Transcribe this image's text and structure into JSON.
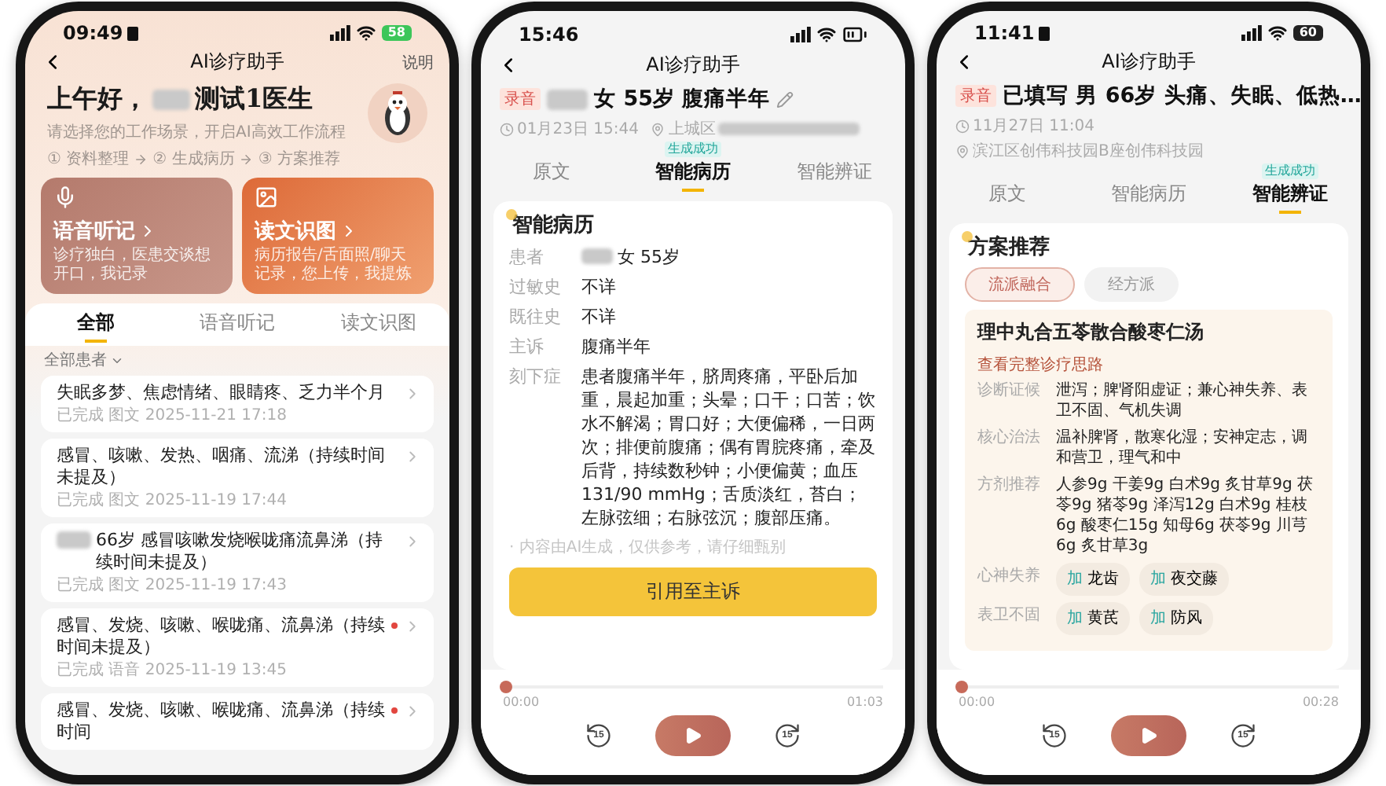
{
  "screens": [
    {
      "kind": "home",
      "status": {
        "time": "09:49",
        "notification": true,
        "battery": "58",
        "charging": true
      },
      "nav": {
        "title": "AI诊疗助手",
        "action": "说明"
      },
      "greeting": "上午好，",
      "doctor_name": "测试1医生",
      "subtitle": "请选择您的工作场景，开启AI高效工作流程",
      "steps": [
        "① 资料整理",
        "② 生成病历",
        "③ 方案推荐"
      ],
      "cards": [
        {
          "kind": "voice",
          "title": "语音听记",
          "description": "诊疗独白，医患交谈想开口，我记录"
        },
        {
          "kind": "image",
          "title": "读文识图",
          "description": "病历报告/舌面照/聊天记录，您上传，我提炼"
        }
      ],
      "tabs": [
        {
          "label": "全部",
          "selected": true
        },
        {
          "label": "语音听记",
          "selected": false
        },
        {
          "label": "读文识图",
          "selected": false
        }
      ],
      "filter": "全部患者",
      "records": [
        {
          "title": "失眠多梦、焦虑情绪、眼睛疼、乏力半个月",
          "name_hidden": false,
          "unread": false,
          "status": "已完成",
          "source": "图文",
          "time": "2025-11-21 17:18"
        },
        {
          "title": "感冒、咳嗽、发热、咽痛、流涕（持续时间未提及）",
          "name_hidden": false,
          "unread": false,
          "status": "已完成",
          "source": "图文",
          "time": "2025-11-19 17:44"
        },
        {
          "title": "66岁 感冒咳嗽发烧喉咙痛流鼻涕（持续时间未提及）",
          "name_hidden": true,
          "unread": false,
          "status": "已完成",
          "source": "图文",
          "time": "2025-11-19 17:43"
        },
        {
          "title": "感冒、发烧、咳嗽、喉咙痛、流鼻涕（持续时间未提及）",
          "name_hidden": false,
          "unread": true,
          "status": "已完成",
          "source": "语音",
          "time": "2025-11-19 13:45"
        },
        {
          "title": "感冒、发烧、咳嗽、喉咙痛、流鼻涕（持续时间",
          "name_hidden": false,
          "unread": true
        }
      ]
    },
    {
      "kind": "record",
      "status": {
        "time": "15:46",
        "notification": false
      },
      "nav": {
        "title": "AI诊疗助手"
      },
      "tag": "录音",
      "title": "女 55岁 腹痛半年",
      "name_hidden": true,
      "date": "01月23日 15:44",
      "location": "上城区",
      "location_hidden": true,
      "tabs": [
        {
          "label": "原文",
          "selected": false
        },
        {
          "label": "智能病历",
          "selected": true,
          "badge": "生成成功"
        },
        {
          "label": "智能辨证",
          "selected": false
        }
      ],
      "card": {
        "title": "智能病历",
        "fields": [
          {
            "label": "患者",
            "value": "女 55岁",
            "name_hidden": true
          },
          {
            "label": "过敏史",
            "value": "不详",
            "name_hidden": false
          },
          {
            "label": "既往史",
            "value": "不详",
            "name_hidden": false
          },
          {
            "label": "主诉",
            "value": "腹痛半年",
            "name_hidden": false
          },
          {
            "label": "刻下症",
            "value": "患者腹痛半年，脐周疼痛，平卧后加重，晨起加重；头晕；口干；口苦；饮水不解渴；胃口好；大便偏稀，一日两次；排便前腹痛；偶有胃脘疼痛，牵及后背，持续数秒钟；小便偏黄；血压131/90 mmHg；舌质淡红，苔白；左脉弦细；右脉弦沉；腹部压痛。",
            "name_hidden": false
          }
        ],
        "note": "· 内容由AI生成，仅供参考，请仔细甄别",
        "button": "引用至主诉"
      },
      "player": {
        "level": 0,
        "start": "00:00",
        "end": "01:03",
        "back": "15",
        "forward": "15"
      }
    },
    {
      "kind": "plan",
      "status": {
        "time": "11:41",
        "notification": true,
        "battery": "60",
        "charging": false
      },
      "nav": {
        "title": "AI诊疗助手"
      },
      "tag": "录音",
      "title": "已填写 男 66岁 头痛、失眠、低热…",
      "name_hidden": false,
      "date": "11月27日 11:04",
      "location": "滨江区创伟科技园B座创伟科技园",
      "location_hidden": false,
      "tabs": [
        {
          "label": "原文",
          "selected": false
        },
        {
          "label": "智能病历",
          "selected": false
        },
        {
          "label": "智能辨证",
          "selected": true,
          "badge": "生成成功"
        }
      ],
      "card": {
        "title": "方案推荐",
        "schools": [
          {
            "label": "流派融合",
            "selected": true
          },
          {
            "label": "经方派",
            "selected": false
          }
        ],
        "plan": {
          "name": "理中丸合五苓散合酸枣仁汤",
          "link": "查看完整诊疗思路",
          "fields": [
            {
              "label": "诊断证候",
              "value": "泄泻；脾肾阳虚证；兼心神失养、表卫不固、气机失调"
            },
            {
              "label": "核心治法",
              "value": "温补脾肾，散寒化湿；安神定志，调和营卫，理气和中"
            },
            {
              "label": "方剂推荐",
              "value": "人参9g 干姜9g 白术9g 炙甘草9g 茯苓9g 猪苓9g 泽泻12g 白术9g 桂枝6g 酸枣仁15g 知母6g 茯苓9g 川芎6g 炙甘草3g"
            }
          ],
          "additions": [
            {
              "label": "心神失养",
              "herbs": [
                {
                  "prefix": "加",
                  "name": "龙齿"
                },
                {
                  "prefix": "加",
                  "name": "夜交藤"
                }
              ]
            },
            {
              "label": "表卫不固",
              "herbs": [
                {
                  "prefix": "加",
                  "name": "黄芪"
                },
                {
                  "prefix": "加",
                  "name": "防风"
                }
              ]
            }
          ]
        }
      },
      "player": {
        "level": 0,
        "start": "00:00",
        "end": "00:28",
        "back": "15",
        "forward": "15"
      }
    }
  ]
}
